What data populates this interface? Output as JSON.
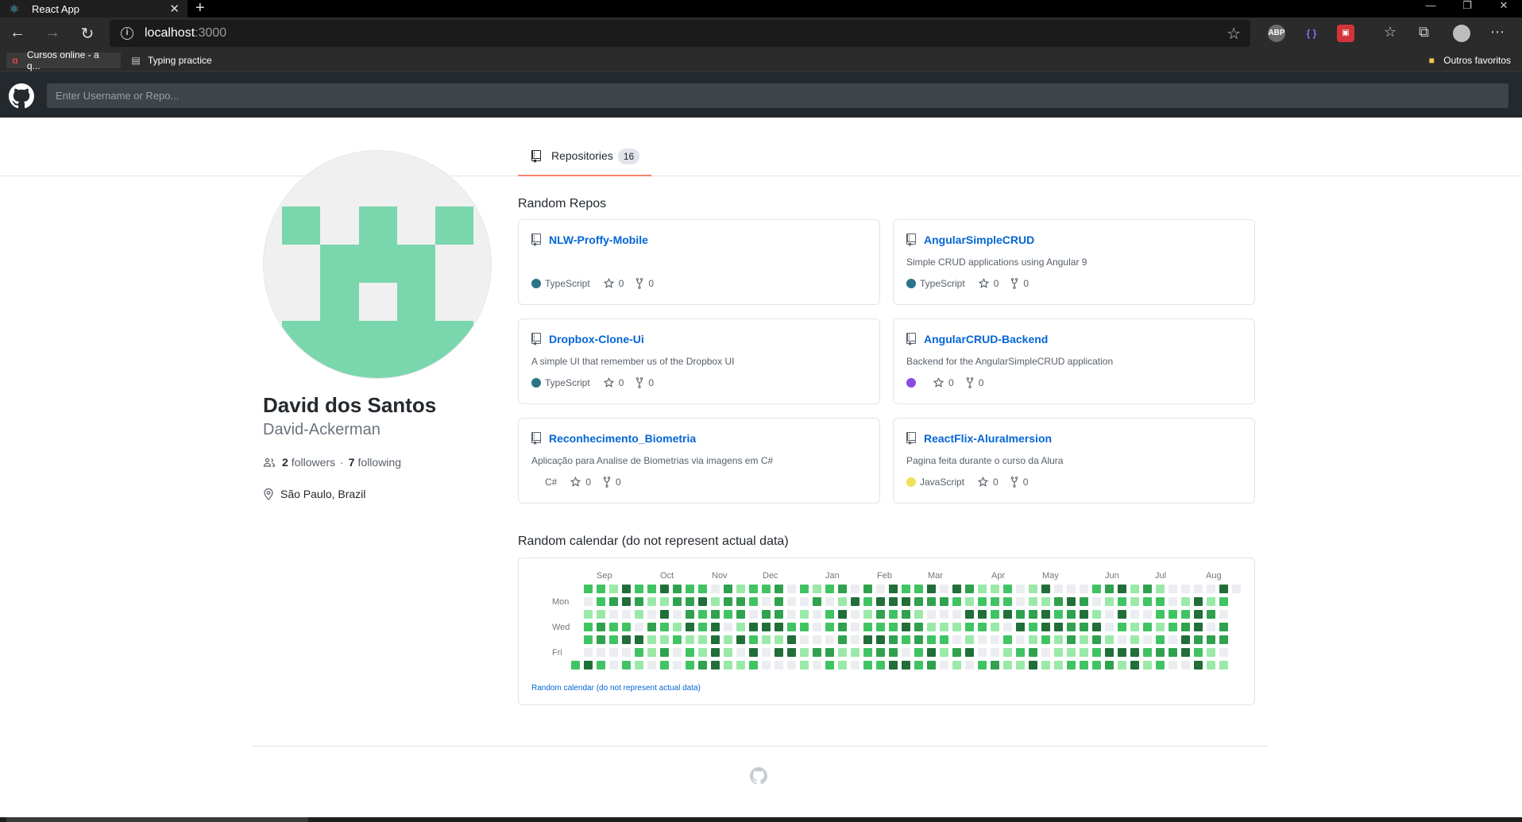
{
  "browser": {
    "tab_title": "React App",
    "tab_close": "✕",
    "new_tab": "+",
    "url_host": "localhost",
    "url_port": ":3000",
    "bookmarks": [
      {
        "label": "Cursos online - a q..."
      },
      {
        "label": "Typing practice"
      }
    ],
    "other_favorites": "Outros favoritos",
    "extensions": [
      {
        "name": "adblock-plus-icon",
        "label": "ABP",
        "color": "#6b6b6b"
      },
      {
        "name": "extension-brackets-icon",
        "label": "{ }",
        "color": "#3a3a8a"
      },
      {
        "name": "extension-red-icon",
        "label": "▣",
        "color": "#d2343a"
      }
    ]
  },
  "header": {
    "search_placeholder": "Enter Username or Repo..."
  },
  "tabs": {
    "repositories_label": "Repositories",
    "repositories_count": "16"
  },
  "profile": {
    "name": "David dos Santos",
    "login": "David-Ackerman",
    "followers": "2",
    "followers_label": "followers",
    "separator": "·",
    "following": "7",
    "following_label": "following",
    "location": "São Paulo, Brazil"
  },
  "random_repos": {
    "title": "Random Repos",
    "repos": [
      {
        "name": "NLW-Proffy-Mobile",
        "description": "",
        "language": "TypeScript",
        "language_color": "#2b7489",
        "stars": "0",
        "forks": "0"
      },
      {
        "name": "AngularSimpleCRUD",
        "description": "Simple CRUD applications using Angular 9",
        "language": "TypeScript",
        "language_color": "#2b7489",
        "stars": "0",
        "forks": "0"
      },
      {
        "name": "Dropbox-Clone-Ui",
        "description": "A simple UI that remember us of the Dropbox UI",
        "language": "TypeScript",
        "language_color": "#2b7489",
        "stars": "0",
        "forks": "0"
      },
      {
        "name": "AngularCRUD-Backend",
        "description": "Backend for the AngularSimpleCRUD application",
        "language": "",
        "language_color": "#8a4be2",
        "stars": "0",
        "forks": "0"
      },
      {
        "name": "Reconhecimento_Biometria",
        "description": "Aplicação para Analise de Biometrias via imagens em C#",
        "language": "C#",
        "language_color": "",
        "stars": "0",
        "forks": "0"
      },
      {
        "name": "ReactFlix-AluraImersion",
        "description": "Pagina feita durante o curso da Alura",
        "language": "JavaScript",
        "language_color": "#f1e05a",
        "stars": "0",
        "forks": "0"
      }
    ]
  },
  "calendar": {
    "title": "Random calendar (do not represent actual data)",
    "link": "Random calendar (do not represent actual data)",
    "months": [
      "Sep",
      "Oct",
      "Nov",
      "Dec",
      "Jan",
      "Feb",
      "Mar",
      "Apr",
      "May",
      "Jun",
      "Jul",
      "Aug"
    ],
    "day_labels": [
      "Mon",
      "Wed",
      "Fri"
    ],
    "colors": [
      "#ebedf0",
      "#9be9a8",
      "#40c463",
      "#30a14e",
      "#216e39"
    ]
  },
  "theme": {
    "accent": "#f9826c",
    "link": "#0366d6",
    "header_bg": "#24292e"
  }
}
